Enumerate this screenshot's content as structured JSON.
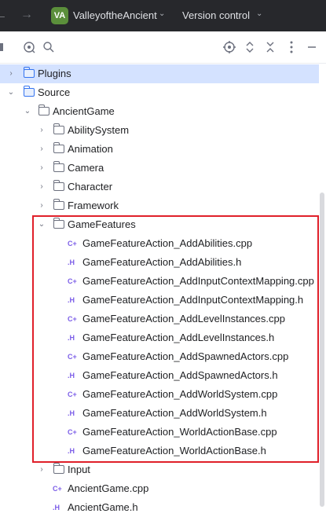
{
  "titlebar": {
    "project_badge": "VA",
    "project_name": "ValleyoftheAncient",
    "version_control": "Version control",
    "back_glyph": "←",
    "forward_glyph": "→",
    "chevron_glyph": "⌄"
  },
  "toolbar": {
    "icons": [
      "panel-icon",
      "refresh-icon",
      "search-icon",
      "locate-icon",
      "expand-collapse-icon",
      "close-icon",
      "more-icon",
      "minimize-icon"
    ]
  },
  "tree": {
    "plugins": "Plugins",
    "source": "Source",
    "ancient_game": "AncientGame",
    "ability_system": "AbilitySystem",
    "animation": "Animation",
    "camera": "Camera",
    "character": "Character",
    "framework": "Framework",
    "game_features": "GameFeatures",
    "files": [
      {
        "icon": "C+",
        "name": "GameFeatureAction_AddAbilities.cpp"
      },
      {
        "icon": ".H",
        "name": "GameFeatureAction_AddAbilities.h"
      },
      {
        "icon": "C+",
        "name": "GameFeatureAction_AddInputContextMapping.cpp"
      },
      {
        "icon": ".H",
        "name": "GameFeatureAction_AddInputContextMapping.h"
      },
      {
        "icon": "C+",
        "name": "GameFeatureAction_AddLevelInstances.cpp"
      },
      {
        "icon": ".H",
        "name": "GameFeatureAction_AddLevelInstances.h"
      },
      {
        "icon": "C+",
        "name": "GameFeatureAction_AddSpawnedActors.cpp"
      },
      {
        "icon": ".H",
        "name": "GameFeatureAction_AddSpawnedActors.h"
      },
      {
        "icon": "C+",
        "name": "GameFeatureAction_AddWorldSystem.cpp"
      },
      {
        "icon": ".H",
        "name": "GameFeatureAction_AddWorldSystem.h"
      },
      {
        "icon": "C+",
        "name": "GameFeatureAction_WorldActionBase.cpp"
      },
      {
        "icon": ".H",
        "name": "GameFeatureAction_WorldActionBase.h"
      }
    ],
    "input": "Input",
    "ancient_game_cpp": {
      "icon": "C+",
      "name": "AncientGame.cpp"
    },
    "ancient_game_h": {
      "icon": ".H",
      "name": "AncientGame.h"
    }
  },
  "glyphs": {
    "collapsed": "›",
    "expanded": "⌄"
  },
  "colors": {
    "titlebar_bg": "#27282c",
    "selection_bg": "#d4e2ff",
    "highlight_border": "#e0202a",
    "cpp_icon": "#7b5de8"
  }
}
